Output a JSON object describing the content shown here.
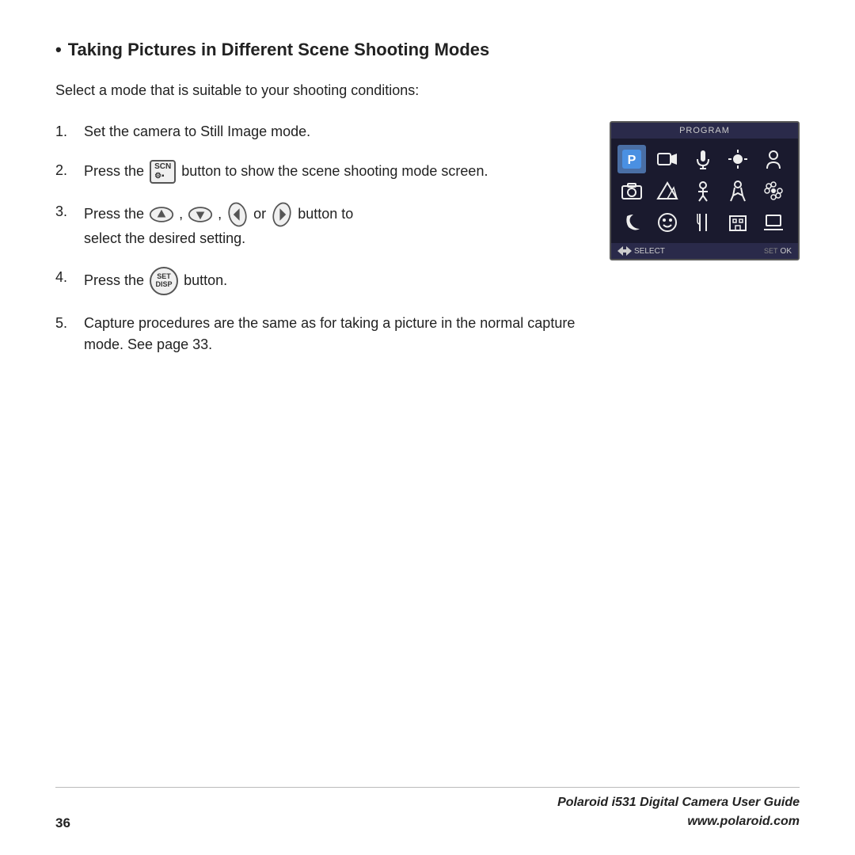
{
  "page": {
    "title": "Taking Pictures in Different Scene Shooting Modes",
    "subtitle": "Select a mode that is suitable to your shooting conditions:",
    "steps": [
      {
        "number": "1.",
        "text": "Set the camera to Still Image mode."
      },
      {
        "number": "2.",
        "text_before": "Press the",
        "icon": "scn-button",
        "text_after": "button to show the scene shooting mode screen."
      },
      {
        "number": "3.",
        "text_before": "Press the",
        "icons": [
          "up-arrow",
          "down-arrow",
          "left-arrow",
          "right-arrow"
        ],
        "or_text": "or",
        "button_to_text": "button to",
        "text_after": "select the desired setting."
      },
      {
        "number": "4.",
        "text_before": "Press the",
        "icon": "set-disp-button",
        "text_after": "button."
      },
      {
        "number": "5.",
        "text": "Capture procedures are the same as for taking a picture in the normal capture mode. See page 33."
      }
    ],
    "program_screen": {
      "header": "PROGRAM",
      "footer_left": "SELECT",
      "footer_right": "OK"
    },
    "footer": {
      "page_number": "36",
      "guide_title": "Polaroid i531 Digital Camera User Guide",
      "website": "www.polaroid.com"
    }
  }
}
